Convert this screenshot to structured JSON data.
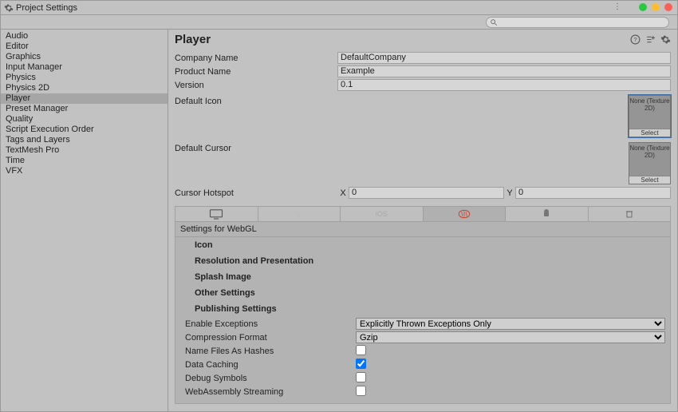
{
  "window": {
    "title": "Project Settings"
  },
  "search": {
    "placeholder": ""
  },
  "sidebar": {
    "items": [
      {
        "label": "Audio"
      },
      {
        "label": "Editor"
      },
      {
        "label": "Graphics"
      },
      {
        "label": "Input Manager"
      },
      {
        "label": "Physics"
      },
      {
        "label": "Physics 2D"
      },
      {
        "label": "Player"
      },
      {
        "label": "Preset Manager"
      },
      {
        "label": "Quality"
      },
      {
        "label": "Script Execution Order"
      },
      {
        "label": "Tags and Layers"
      },
      {
        "label": "TextMesh Pro"
      },
      {
        "label": "Time"
      },
      {
        "label": "VFX"
      }
    ],
    "selected": 6
  },
  "main": {
    "title": "Player",
    "company_label": "Company Name",
    "company_value": "DefaultCompany",
    "product_label": "Product Name",
    "product_value": "Example",
    "version_label": "Version",
    "version_value": "0.1",
    "default_icon_label": "Default Icon",
    "default_cursor_label": "Default Cursor",
    "texture_none": "None (Texture 2D)",
    "select_label": "Select",
    "cursor_hotspot_label": "Cursor Hotspot",
    "cursor_x_label": "X",
    "cursor_x_value": "0",
    "cursor_y_label": "Y",
    "cursor_y_value": "0",
    "platform_section_label": "Settings for WebGL",
    "foldouts": {
      "icon": "Icon",
      "resolution": "Resolution and Presentation",
      "splash": "Splash Image",
      "other": "Other Settings",
      "publishing": "Publishing Settings"
    },
    "publishing": {
      "enable_exceptions_label": "Enable Exceptions",
      "enable_exceptions_value": "Explicitly Thrown Exceptions Only",
      "compression_label": "Compression Format",
      "compression_value": "Gzip",
      "name_hashes_label": "Name Files As Hashes",
      "name_hashes_value": false,
      "data_caching_label": "Data Caching",
      "data_caching_value": true,
      "debug_symbols_label": "Debug Symbols",
      "debug_symbols_value": false,
      "wasm_streaming_label": "WebAssembly Streaming",
      "wasm_streaming_value": false
    }
  }
}
